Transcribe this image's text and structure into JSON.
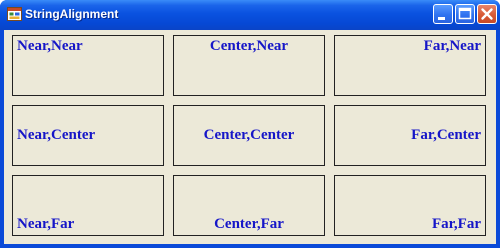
{
  "window": {
    "title": "StringAlignment",
    "app_icon": "windows-form-icon",
    "controls": {
      "minimize_icon": "minimize-icon",
      "maximize_icon": "maximize-icon",
      "close_icon": "close-icon"
    }
  },
  "colors": {
    "title_bar": "#0a52e0",
    "client_background": "#ece9d8",
    "label_text": "#1616c8",
    "panel_border": "#222222"
  },
  "panels": {
    "near_near": "Near,Near",
    "center_near": "Center,Near",
    "far_near": "Far,Near",
    "near_center": "Near,Center",
    "center_center": "Center,Center",
    "far_center": "Far,Center",
    "near_far": "Near,Far",
    "center_far": "Center,Far",
    "far_far": "Far,Far"
  }
}
